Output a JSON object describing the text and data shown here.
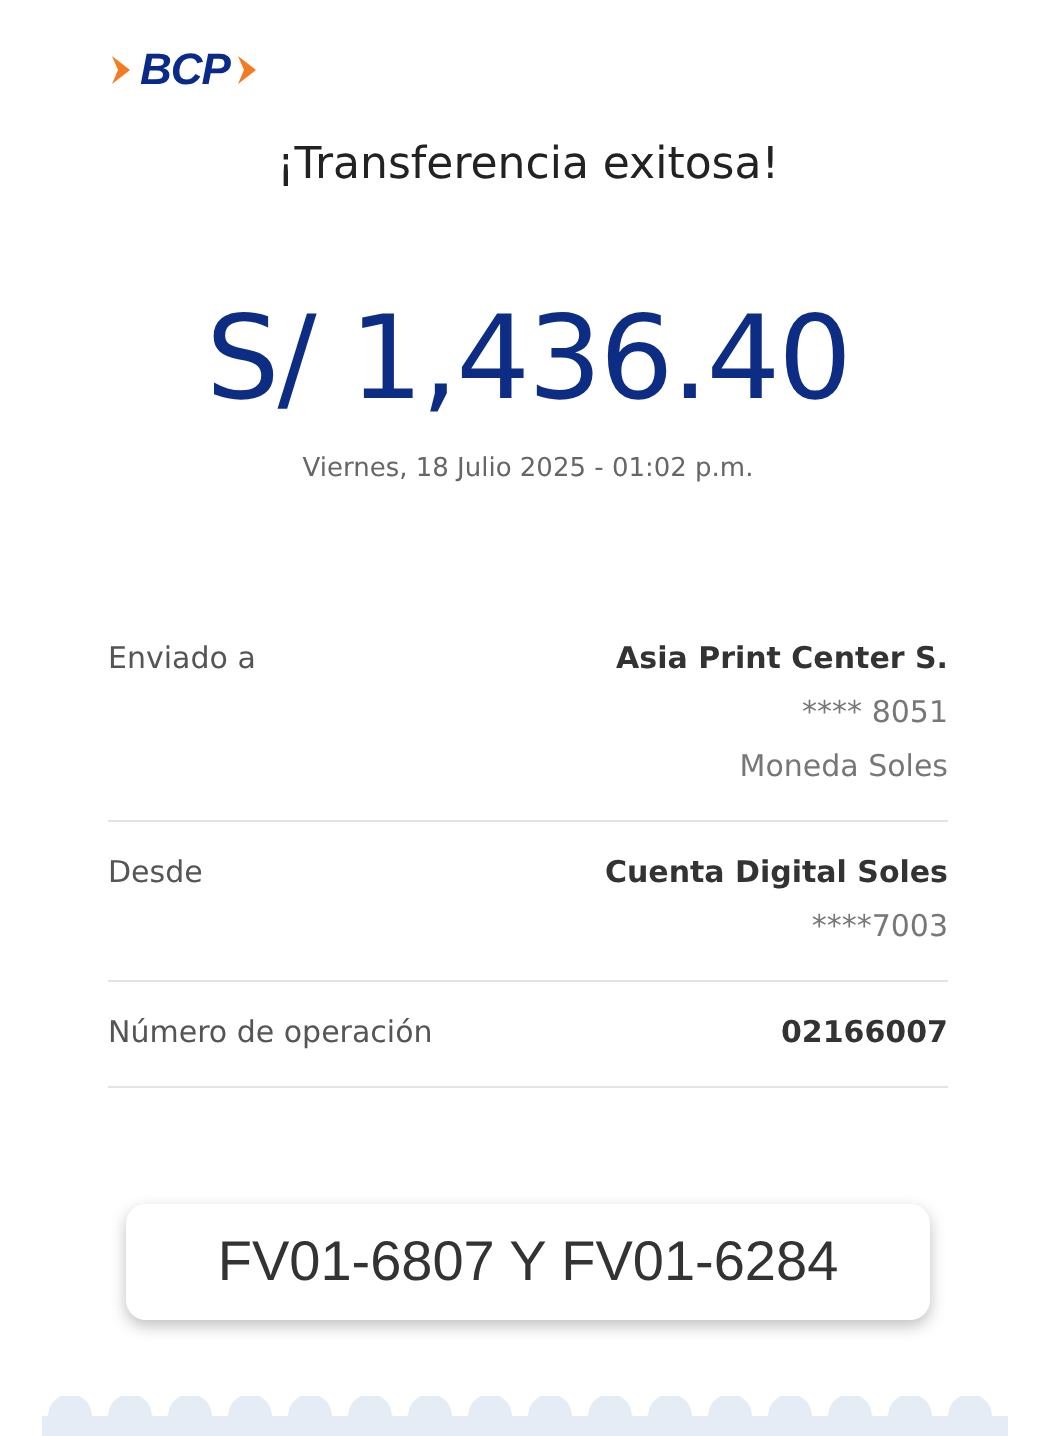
{
  "logo": {
    "text": "BCP"
  },
  "title": "¡Transferencia exitosa!",
  "amount": "S/ 1,436.40",
  "date": "Viernes, 18 Julio 2025 - 01:02 p.m.",
  "details": [
    {
      "label": "Enviado a",
      "values": [
        "Asia Print Center S.",
        "**** 8051",
        "Moneda Soles"
      ]
    },
    {
      "label": "Desde",
      "values": [
        "Cuenta Digital Soles",
        "****7003"
      ]
    },
    {
      "label": "Número de operación",
      "values": [
        "02166007"
      ]
    }
  ],
  "note": "FV01-6807 Y FV01-6284"
}
